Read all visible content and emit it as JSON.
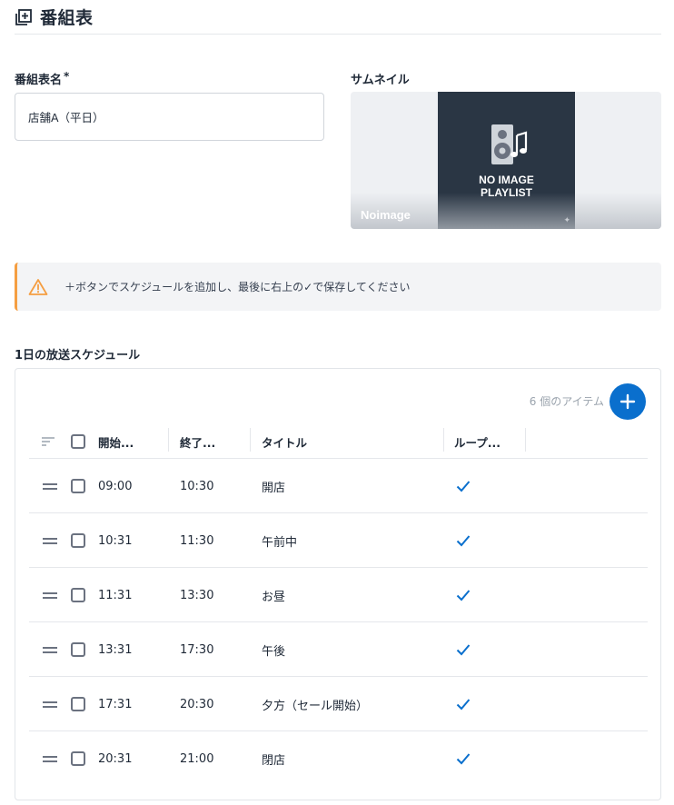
{
  "header": {
    "title": "番組表",
    "icon": "add-box-icon"
  },
  "form": {
    "name_label": "番組表名",
    "required_mark": "*",
    "name_value": "店舗A（平日）",
    "thumbnail_label": "サムネイル",
    "thumbnail": {
      "poster_line1": "NO IMAGE",
      "poster_line2": "PLAYLIST",
      "caption": "Noimage",
      "poster_icon": "speaker-music-icon"
    }
  },
  "alert": {
    "icon": "warning-icon",
    "message": "＋ボタンでスケジュールを追加し、最後に右上の✓で保存してください",
    "accent": "#f59e42"
  },
  "schedule": {
    "section_title": "1日の放送スケジュール",
    "item_count": "6 個のアイテム",
    "add_icon": "plus-icon",
    "accent": "#0a6fcd",
    "columns": {
      "start": "開始...",
      "end": "終了...",
      "title": "タイトル",
      "loop": "ループ..."
    },
    "rows": [
      {
        "start": "09:00",
        "end": "10:30",
        "title": "開店",
        "loop": true
      },
      {
        "start": "10:31",
        "end": "11:30",
        "title": "午前中",
        "loop": true
      },
      {
        "start": "11:31",
        "end": "13:30",
        "title": "お昼",
        "loop": true
      },
      {
        "start": "13:31",
        "end": "17:30",
        "title": "午後",
        "loop": true
      },
      {
        "start": "17:31",
        "end": "20:30",
        "title": "夕方（セール開始）",
        "loop": true
      },
      {
        "start": "20:31",
        "end": "21:00",
        "title": "閉店",
        "loop": true
      }
    ]
  }
}
